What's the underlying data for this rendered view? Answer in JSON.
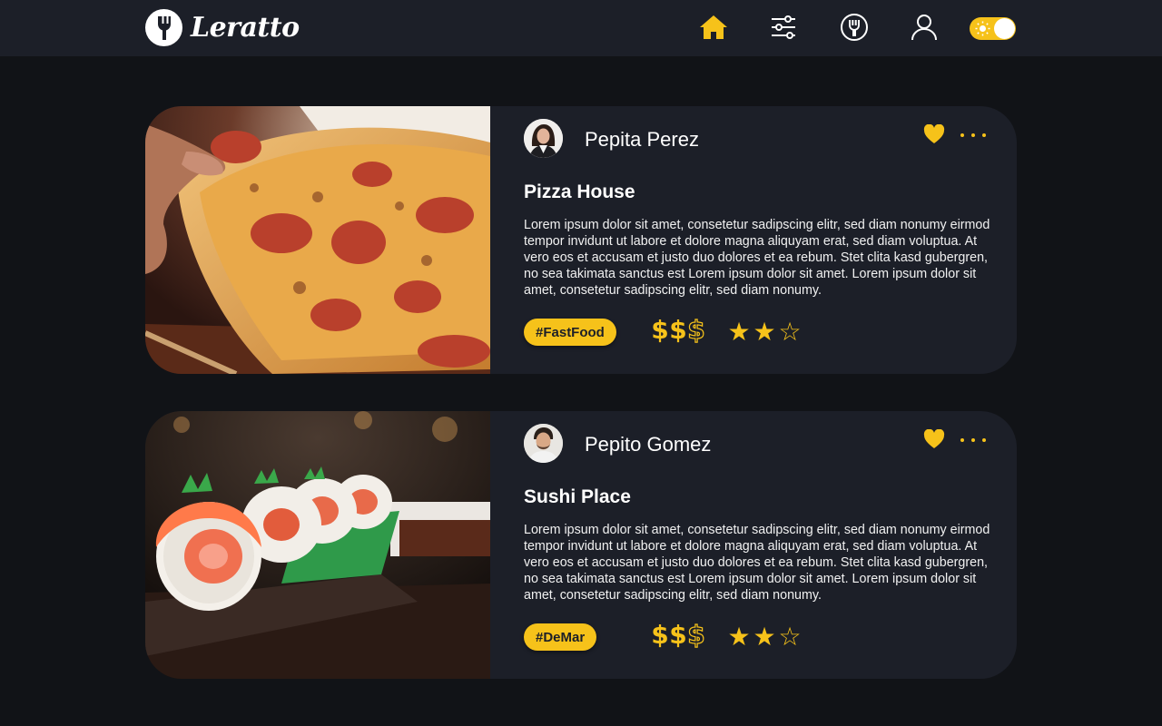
{
  "app": {
    "name": "Leratto"
  },
  "nav": {
    "items": [
      {
        "icon": "home-icon",
        "active": true
      },
      {
        "icon": "filters-icon",
        "active": false
      },
      {
        "icon": "restaurant-icon",
        "active": false
      },
      {
        "icon": "user-icon",
        "active": false
      }
    ],
    "theme_toggle": {
      "icon": "sun-icon",
      "state": "light"
    }
  },
  "colors": {
    "accent": "#f6c21a",
    "background": "#111317",
    "surface": "#1c1f28"
  },
  "posts": [
    {
      "author": "Pepita Perez",
      "title": "Pizza House",
      "description": "Lorem ipsum dolor sit amet, consetetur sadipscing elitr, sed diam nonumy eirmod tempor invidunt ut labore et dolore magna aliquyam erat, sed diam voluptua. At vero eos et accusam et justo duo dolores et ea rebum. Stet clita kasd gubergren, no sea takimata sanctus est Lorem ipsum dolor sit amet. Lorem ipsum dolor sit amet, consetetur sadipscing elitr, sed diam nonumy.",
      "tag": "#FastFood",
      "price_level": 2,
      "price_max": 3,
      "rating": 2,
      "rating_max": 3,
      "liked": true
    },
    {
      "author": "Pepito Gomez",
      "title": "Sushi Place",
      "description": "Lorem ipsum dolor sit amet, consetetur sadipscing elitr, sed diam nonumy eirmod tempor invidunt ut labore et dolore magna aliquyam erat, sed diam voluptua. At vero eos et accusam et justo duo dolores et ea rebum. Stet clita kasd gubergren, no sea takimata sanctus est Lorem ipsum dolor sit amet. Lorem ipsum dolor sit amet, consetetur sadipscing elitr, sed diam nonumy.",
      "tag": "#DeMar",
      "price_level": 2,
      "price_max": 3,
      "rating": 2,
      "rating_max": 3,
      "liked": true
    }
  ]
}
